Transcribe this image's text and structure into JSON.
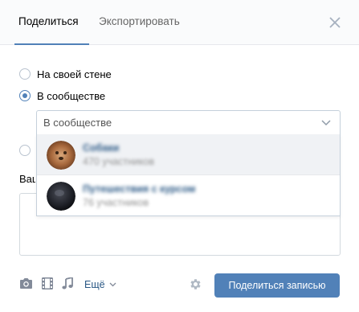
{
  "tabs": {
    "share": "Поделиться",
    "export": "Экспортировать"
  },
  "options": {
    "own_wall": "На своей стене",
    "community": "В сообществе"
  },
  "community_select": {
    "value": "В сообществе"
  },
  "comment_label": "Ваш",
  "dropdown": {
    "items": [
      {
        "name": "Собаки",
        "members": "470 участников"
      },
      {
        "name": "Путешествия с курсом",
        "members": "76 участников"
      }
    ]
  },
  "footer": {
    "more_label": "Ещё",
    "share_button": "Поделиться записью"
  },
  "colors": {
    "accent": "#5181b8",
    "link": "#2a5885"
  }
}
